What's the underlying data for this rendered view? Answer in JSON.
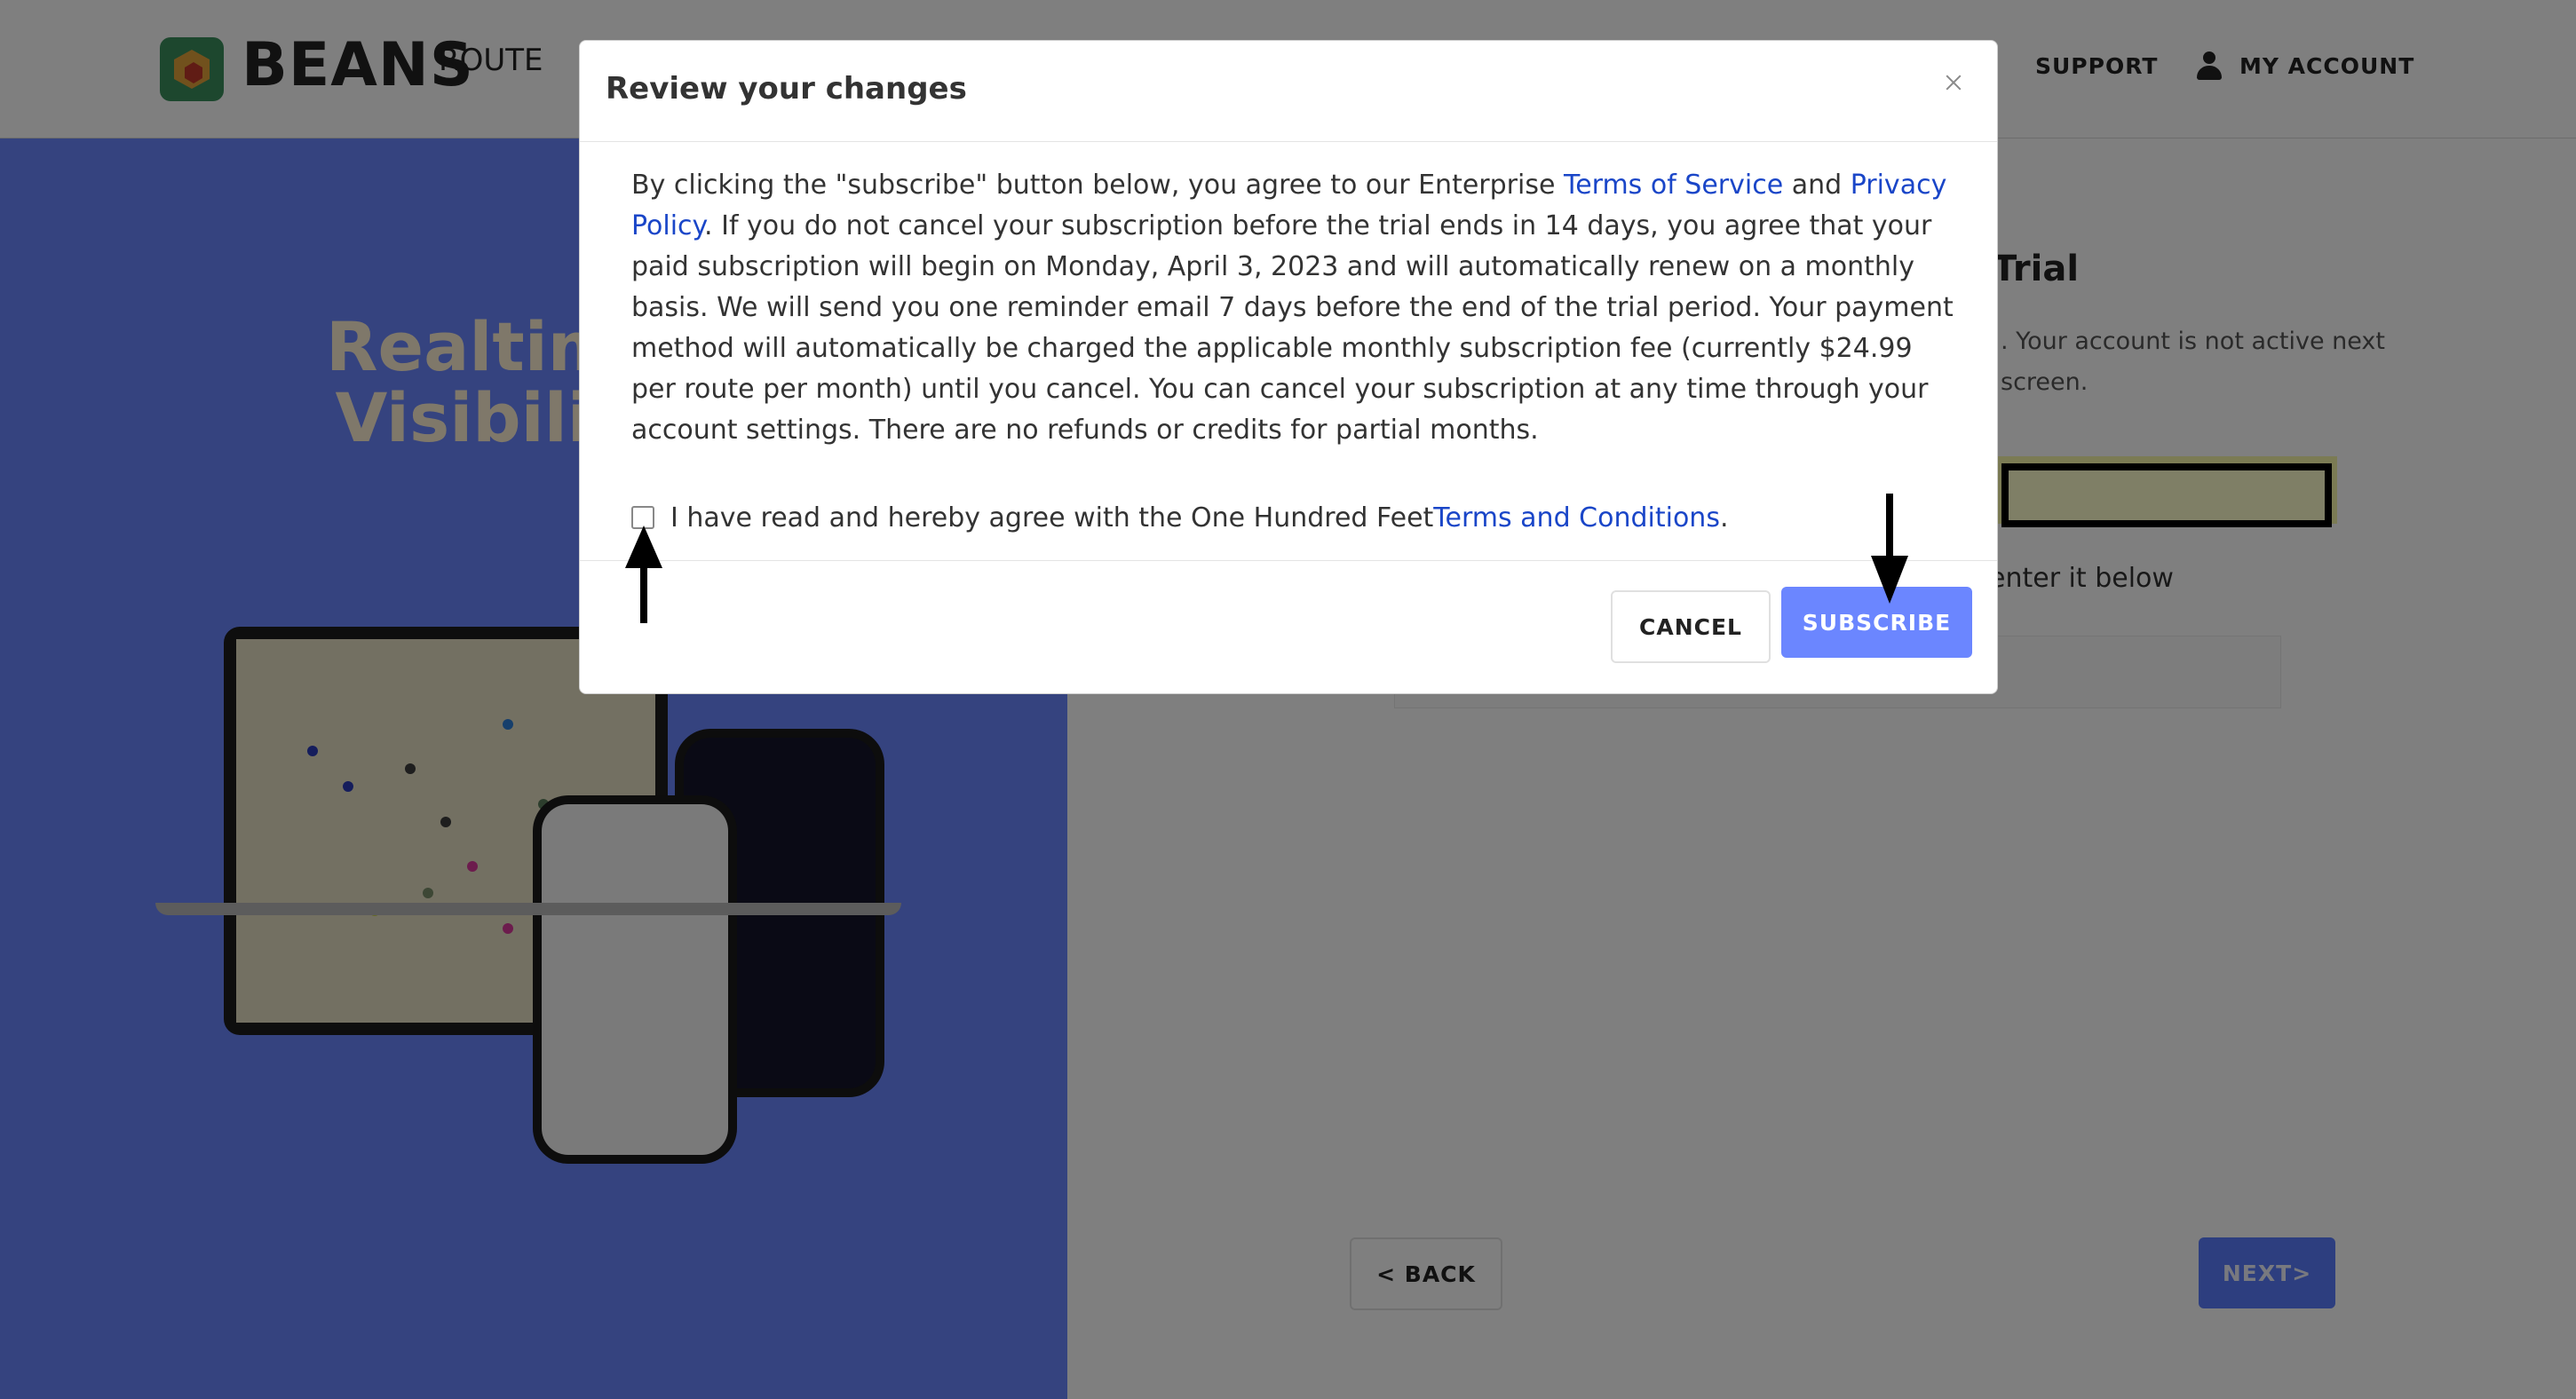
{
  "header": {
    "logo_word": "BEANS",
    "logo_sub": "ROUTE",
    "nav_support": "SUPPORT",
    "nav_account": "MY ACCOUNT"
  },
  "hero": {
    "line1": "Realtime Op",
    "line2": "Visibility an"
  },
  "right": {
    "title": "Trial",
    "text": ". Your account is not active next screen.",
    "enter_text": "enter it below",
    "back_label": "< BACK",
    "next_label": "NEXT>"
  },
  "modal": {
    "title": "Review your changes",
    "body_1": "By clicking the \"subscribe\" button below, you agree to our Enterprise ",
    "terms_link": "Terms of Service",
    "body_and": " and ",
    "privacy_link": "Privacy Policy",
    "body_2": ". If you do not cancel your subscription before the trial ends in 14 days, you agree that your paid subscription will begin on Monday, April 3, 2023 and will automatically renew on a monthly basis. We will send you one reminder email 7 days before the end of the trial period. Your payment method will automatically be charged the applicable monthly subscription fee (currently $24.99 per route per month) until you cancel. You can cancel your subscription at any time through your account settings. There are no refunds or credits for partial months.",
    "agree_text": "I have read and hereby agree with the One Hundred Feet ",
    "agree_link": "Terms and Conditions",
    "agree_end": ".",
    "cancel_label": "CANCEL",
    "subscribe_label": "SUBSCRIBE"
  },
  "colors": {
    "accent": "#6b86ff",
    "link": "#1a46c8",
    "hero_text": "#fff0d4"
  }
}
